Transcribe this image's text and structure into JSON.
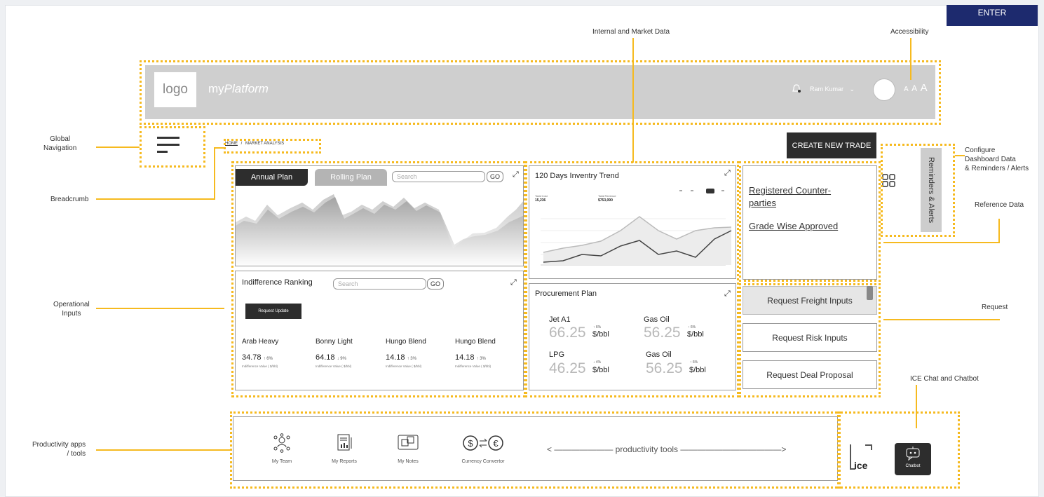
{
  "enter_label": "ENTER",
  "annotations": {
    "internal_market": "Internal and Market Data",
    "accessibility": "Accessibility",
    "global_nav": "Global\nNavigation",
    "breadcrumb": "Breadcrumb",
    "configure": "Configure\nDashboard Data\n& Reminders / Alerts",
    "reference": "Reference Data",
    "operational": "Operational\nInputs",
    "request": "Request",
    "ice": "ICE Chat and Chatbot",
    "productivity": "Productivity apps\n/ tools"
  },
  "header": {
    "logo": "logo",
    "brand_prefix": "my",
    "brand_suffix": "Platform",
    "user": "Ram Kumar",
    "font_sizes": [
      "A",
      "A",
      "A"
    ]
  },
  "breadcrumb": {
    "home": "HOME",
    "sep": "/",
    "current": "MARKET ANALYSIS"
  },
  "create_trade": "CREATE NEW TRADE",
  "plan_panel": {
    "tab_annual": "Annual Plan",
    "tab_rolling": "Rolling Plan",
    "search_placeholder": "Search",
    "go": "GO"
  },
  "indifference": {
    "title": "Indifference Ranking",
    "search_placeholder": "Search",
    "go": "GO",
    "request_update": "Request Update",
    "items": [
      {
        "name": "Arab Heavy",
        "value": "34.78",
        "change": "↑ 6%",
        "sub": "Indifference Value ( $/bbl)"
      },
      {
        "name": "Bonny Light",
        "value": "64.18",
        "change": "↓ 9%",
        "sub": "Indifference Value ( $/bbl)"
      },
      {
        "name": "Hungo Blend",
        "value": "14.18",
        "change": "↑ 3%",
        "sub": "Indifference Value ( $/bbl)"
      },
      {
        "name": "Hungo Blend",
        "value": "14.18",
        "change": "↑ 3%",
        "sub": "Indifference Value ( $/bbl)"
      }
    ]
  },
  "inventory": {
    "title": "120 Days Inventry Trend",
    "total_cost_label": "Total Cost",
    "total_cost_value": "15,236",
    "total_revenue_label": "Total Revenue",
    "total_revenue_value": "$753,090"
  },
  "procurement": {
    "title": "Procurement Plan",
    "items": [
      {
        "name": "Jet A1",
        "value": "66.25",
        "unit": "$/bbl",
        "change": "↑ 6%"
      },
      {
        "name": "Gas Oil",
        "value": "56.25",
        "unit": "$/bbl",
        "change": "↑ 6%"
      },
      {
        "name": "LPG",
        "value": "46.25",
        "unit": "$/bbl",
        "change": "↓ 4%"
      },
      {
        "name": "Gas Oil",
        "value": "56.25",
        "unit": "$/bbl",
        "change": "↑ 6%"
      }
    ]
  },
  "reference": {
    "link1": "Registered Counter-parties",
    "link2": "Grade Wise Approved"
  },
  "reminders": "Reminders & Alerts",
  "requests": [
    "Request Freight Inputs",
    "Request Risk Inputs",
    "Request Deal Proposal"
  ],
  "tools": {
    "items": [
      "My Team",
      "My Reports",
      "My Notes",
      "Currency Convertor"
    ],
    "banner": "< ———————  productivity tools ————————————>"
  },
  "ice": {
    "logo": "ICE",
    "chatbot": "Chatbot"
  }
}
